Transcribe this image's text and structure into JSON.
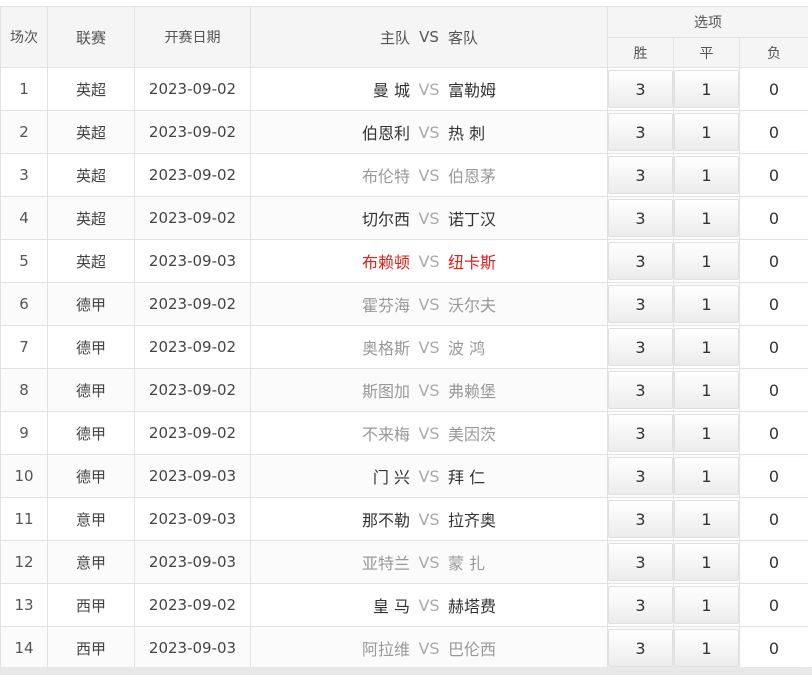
{
  "header": {
    "col_round": "场次",
    "col_league": "联赛",
    "col_date": "开赛日期",
    "col_home": "主队",
    "col_vs": "VS",
    "col_away": "客队",
    "col_options": "选项",
    "opt_win": "胜",
    "opt_draw": "平",
    "opt_lose": "负"
  },
  "colors": {
    "header_bg": "#f5f5f5",
    "border": "#e3e3e3",
    "muted_team": "#999999",
    "highlight_team": "#e0201c"
  },
  "rows": [
    {
      "no": "1",
      "league": "英超",
      "date": "2023-09-02",
      "home": "曼 城",
      "away": "富勒姆",
      "home_style": "normal",
      "away_style": "normal",
      "win": "3",
      "draw": "1",
      "lose": "0"
    },
    {
      "no": "2",
      "league": "英超",
      "date": "2023-09-02",
      "home": "伯恩利",
      "away": "热 刺",
      "home_style": "normal",
      "away_style": "normal",
      "win": "3",
      "draw": "1",
      "lose": "0"
    },
    {
      "no": "3",
      "league": "英超",
      "date": "2023-09-02",
      "home": "布伦特",
      "away": "伯恩茅",
      "home_style": "gray",
      "away_style": "gray",
      "win": "3",
      "draw": "1",
      "lose": "0"
    },
    {
      "no": "4",
      "league": "英超",
      "date": "2023-09-02",
      "home": "切尔西",
      "away": "诺丁汉",
      "home_style": "normal",
      "away_style": "normal",
      "win": "3",
      "draw": "1",
      "lose": "0"
    },
    {
      "no": "5",
      "league": "英超",
      "date": "2023-09-03",
      "home": "布赖顿",
      "away": "纽卡斯",
      "home_style": "red",
      "away_style": "red",
      "win": "3",
      "draw": "1",
      "lose": "0"
    },
    {
      "no": "6",
      "league": "德甲",
      "date": "2023-09-02",
      "home": "霍芬海",
      "away": "沃尔夫",
      "home_style": "gray",
      "away_style": "gray",
      "win": "3",
      "draw": "1",
      "lose": "0"
    },
    {
      "no": "7",
      "league": "德甲",
      "date": "2023-09-02",
      "home": "奥格斯",
      "away": "波 鸿",
      "home_style": "gray",
      "away_style": "gray",
      "win": "3",
      "draw": "1",
      "lose": "0"
    },
    {
      "no": "8",
      "league": "德甲",
      "date": "2023-09-02",
      "home": "斯图加",
      "away": "弗赖堡",
      "home_style": "gray",
      "away_style": "gray",
      "win": "3",
      "draw": "1",
      "lose": "0"
    },
    {
      "no": "9",
      "league": "德甲",
      "date": "2023-09-02",
      "home": "不来梅",
      "away": "美因茨",
      "home_style": "gray",
      "away_style": "gray",
      "win": "3",
      "draw": "1",
      "lose": "0"
    },
    {
      "no": "10",
      "league": "德甲",
      "date": "2023-09-03",
      "home": "门 兴",
      "away": "拜 仁",
      "home_style": "normal",
      "away_style": "normal",
      "win": "3",
      "draw": "1",
      "lose": "0"
    },
    {
      "no": "11",
      "league": "意甲",
      "date": "2023-09-03",
      "home": "那不勒",
      "away": "拉齐奥",
      "home_style": "normal",
      "away_style": "normal",
      "win": "3",
      "draw": "1",
      "lose": "0"
    },
    {
      "no": "12",
      "league": "意甲",
      "date": "2023-09-03",
      "home": "亚特兰",
      "away": "蒙 扎",
      "home_style": "gray",
      "away_style": "gray",
      "win": "3",
      "draw": "1",
      "lose": "0"
    },
    {
      "no": "13",
      "league": "西甲",
      "date": "2023-09-02",
      "home": "皇 马",
      "away": "赫塔费",
      "home_style": "normal",
      "away_style": "normal",
      "win": "3",
      "draw": "1",
      "lose": "0"
    },
    {
      "no": "14",
      "league": "西甲",
      "date": "2023-09-03",
      "home": "阿拉维",
      "away": "巴伦西",
      "home_style": "gray",
      "away_style": "gray",
      "win": "3",
      "draw": "1",
      "lose": "0"
    }
  ]
}
